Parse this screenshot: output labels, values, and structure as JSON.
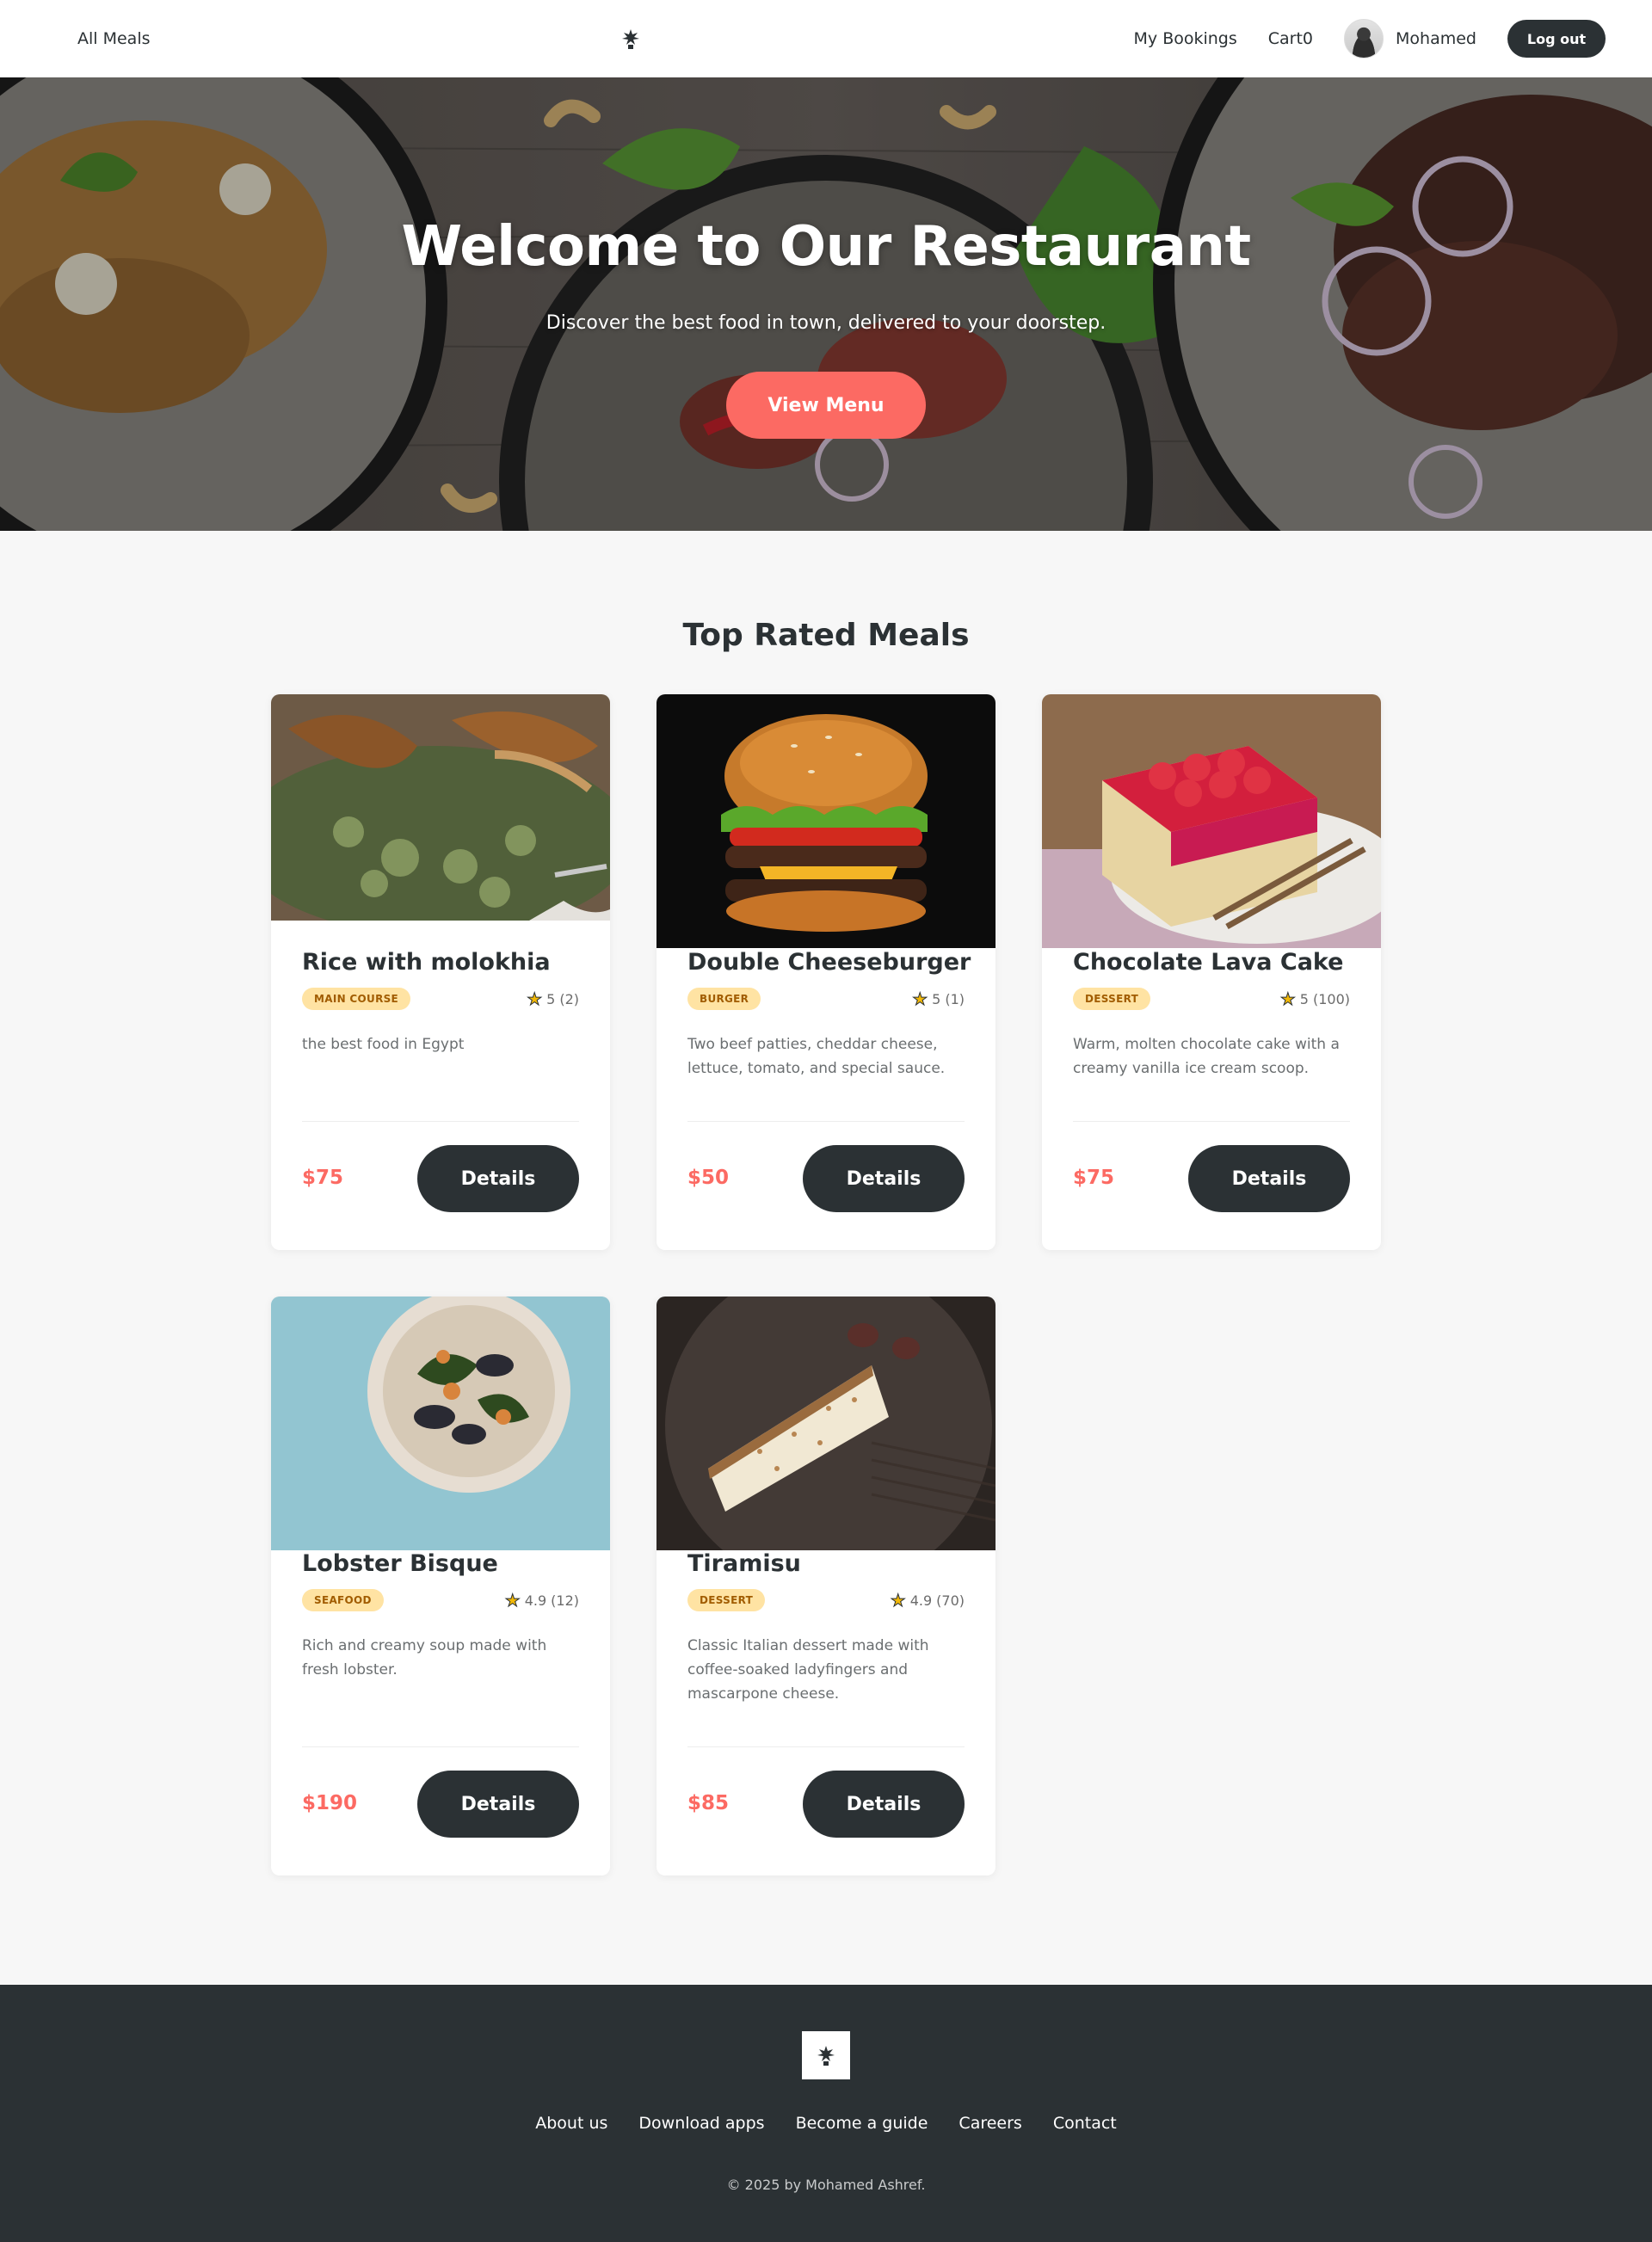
{
  "nav": {
    "all_meals": "All Meals",
    "logo_icon": "chef-hat-logo-icon",
    "my_bookings": "My Bookings",
    "cart": "Cart0",
    "user_name": "Mohamed",
    "logout": "Log out"
  },
  "hero": {
    "title": "Welcome to Our Restaurant",
    "subtitle": "Discover the best food in town, delivered to your doorstep.",
    "cta": "View Menu"
  },
  "section": {
    "title": "Top Rated Meals"
  },
  "meals": [
    {
      "name": "Rice with molokhia",
      "category": "MAIN COURSE",
      "rating": "5",
      "reviews": "(2)",
      "description": "the best food in Egypt",
      "price": "$75",
      "button": "Details"
    },
    {
      "name": "Double Cheeseburger",
      "category": "BURGER",
      "rating": "5",
      "reviews": "(1)",
      "description": "Two beef patties, cheddar cheese, lettuce, tomato, and special sauce.",
      "price": "$50",
      "button": "Details"
    },
    {
      "name": "Chocolate Lava Cake",
      "category": "DESSERT",
      "rating": "5",
      "reviews": "(100)",
      "description": "Warm, molten chocolate cake with a creamy vanilla ice cream scoop.",
      "price": "$75",
      "button": "Details"
    },
    {
      "name": "Lobster Bisque",
      "category": "SEAFOOD",
      "rating": "4.9",
      "reviews": "(12)",
      "description": "Rich and creamy soup made with fresh lobster.",
      "price": "$190",
      "button": "Details"
    },
    {
      "name": "Tiramisu",
      "category": "DESSERT",
      "rating": "4.9",
      "reviews": "(70)",
      "description": "Classic Italian dessert made with coffee-soaked ladyfingers and mascarpone cheese.",
      "price": "$85",
      "button": "Details"
    }
  ],
  "footer": {
    "links": [
      "About us",
      "Download apps",
      "Become a guide",
      "Careers",
      "Contact"
    ],
    "copyright": "© 2025 by Mohamed Ashref."
  },
  "colors": {
    "accent": "#fc6a63",
    "dark": "#2b3134",
    "badge_bg": "#ffe3a3",
    "badge_text": "#a15c00",
    "page_bg": "#f7f7f7"
  }
}
